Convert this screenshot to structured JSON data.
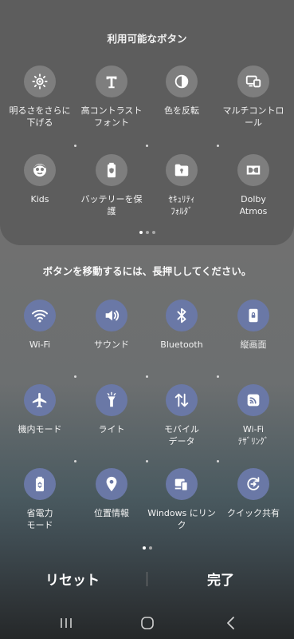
{
  "available_panel": {
    "title": "利用可能なボタン",
    "tiles": [
      {
        "label": "明るさをさらに\n下げる",
        "icon": "extra-dim-icon"
      },
      {
        "label": "高コントラスト\nフォント",
        "icon": "high-contrast-font-icon"
      },
      {
        "label": "色を反転",
        "icon": "color-inversion-icon"
      },
      {
        "label": "マルチコントロ\nール",
        "icon": "multi-control-icon"
      },
      {
        "label": "Kids",
        "icon": "kids-icon"
      },
      {
        "label": "バッテリーを保\n護",
        "icon": "battery-protect-icon"
      },
      {
        "label": "ｾｷｭﾘﾃｨ\nﾌｫﾙﾀﾞ",
        "icon": "secure-folder-icon"
      },
      {
        "label": "Dolby\nAtmos",
        "icon": "dolby-atmos-icon"
      }
    ]
  },
  "instruction": "ボタンを移動するには、長押ししてください。",
  "active_panel": {
    "tiles": [
      {
        "label": "Wi-Fi",
        "icon": "wifi-icon"
      },
      {
        "label": "サウンド",
        "icon": "sound-icon"
      },
      {
        "label": "Bluetooth",
        "icon": "bluetooth-icon"
      },
      {
        "label": "縦画面",
        "icon": "portrait-lock-icon"
      },
      {
        "label": "機内モード",
        "icon": "airplane-icon"
      },
      {
        "label": "ライト",
        "icon": "flashlight-icon"
      },
      {
        "label": "モバイル\nデータ",
        "icon": "mobile-data-icon"
      },
      {
        "label": "Wi-Fi\nﾃｻﾞﾘﾝｸﾞ",
        "icon": "wifi-tethering-icon"
      },
      {
        "label": "省電力\nモード",
        "icon": "power-saving-icon"
      },
      {
        "label": "位置情報",
        "icon": "location-icon"
      },
      {
        "label": "Windows にリン\nク",
        "icon": "link-to-windows-icon"
      },
      {
        "label": "クイック共有",
        "icon": "quick-share-icon"
      }
    ]
  },
  "actions": {
    "reset": "リセット",
    "done": "完了"
  },
  "colors": {
    "active_circle": "#6a78a6",
    "available_circle": "#7e7e7e",
    "panel": "#5d5d5d"
  },
  "navbar": {
    "icons": [
      "recent-apps-icon",
      "home-icon",
      "back-icon"
    ]
  }
}
